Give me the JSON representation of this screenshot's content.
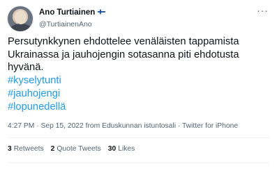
{
  "author": {
    "display_name": "Ano Turtiainen",
    "handle": "@TurtiainenAno",
    "flag_icon": "finnish-flag-icon"
  },
  "tweet": {
    "text_lines": [
      "Persutynkkynen ehdottelee venäläisten tappamista",
      "Ukrainassa ja jauhojengin sotasanna piti ehdotusta",
      "hyvänä."
    ],
    "hashtags": [
      "#kyselytunti",
      "#jauhojengi",
      "#lopunedellä"
    ]
  },
  "meta": {
    "timestamp": "4:27 PM · Sep 15, 2022 from Eduskunnan istuntosali · Twitter for iPhone"
  },
  "stats": [
    {
      "count": "3",
      "label": "Retweets"
    },
    {
      "count": "2",
      "label": "Quote Tweets"
    },
    {
      "count": "30",
      "label": "Likes"
    }
  ],
  "colors": {
    "hashtag": "#1d9bf0",
    "secondary_text": "#536471",
    "primary_text": "#0f1419"
  }
}
